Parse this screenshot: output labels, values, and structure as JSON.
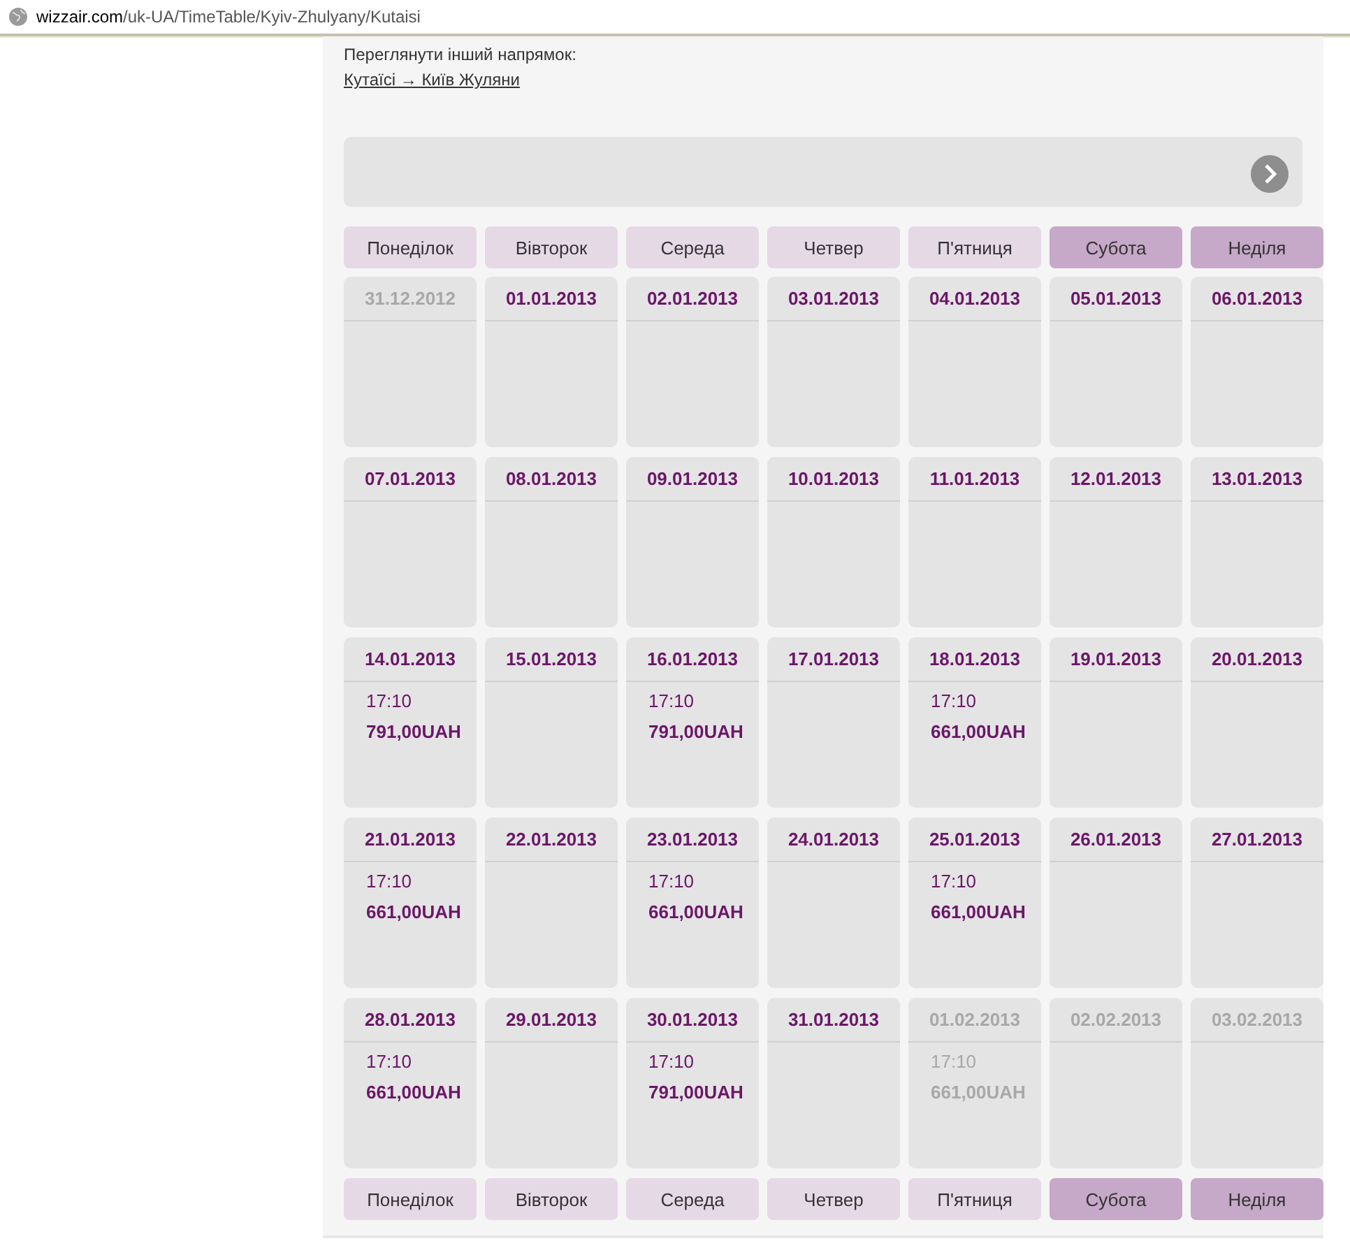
{
  "address_bar": {
    "host": "wizzair.com",
    "path": "/uk-UA/TimeTable/Kyiv-Zhulyany/Kutaisi"
  },
  "other_direction": {
    "label": "Переглянути інший напрямок:",
    "link": "Кутаїсі → Київ Жуляни"
  },
  "weekdays_top": [
    {
      "label": "Понеділок",
      "weekend": false
    },
    {
      "label": "Вівторок",
      "weekend": false
    },
    {
      "label": "Середа",
      "weekend": false
    },
    {
      "label": "Четвер",
      "weekend": false
    },
    {
      "label": "П'ятниця",
      "weekend": false
    },
    {
      "label": "Субота",
      "weekend": true
    },
    {
      "label": "Неділя",
      "weekend": true
    }
  ],
  "days": [
    {
      "date": "31.12.2012",
      "muted": true
    },
    {
      "date": "01.01.2013",
      "muted": false
    },
    {
      "date": "02.01.2013",
      "muted": false
    },
    {
      "date": "03.01.2013",
      "muted": false
    },
    {
      "date": "04.01.2013",
      "muted": false
    },
    {
      "date": "05.01.2013",
      "muted": false
    },
    {
      "date": "06.01.2013",
      "muted": false
    },
    {
      "date": "07.01.2013",
      "muted": false
    },
    {
      "date": "08.01.2013",
      "muted": false
    },
    {
      "date": "09.01.2013",
      "muted": false
    },
    {
      "date": "10.01.2013",
      "muted": false
    },
    {
      "date": "11.01.2013",
      "muted": false
    },
    {
      "date": "12.01.2013",
      "muted": false
    },
    {
      "date": "13.01.2013",
      "muted": false
    },
    {
      "date": "14.01.2013",
      "muted": false,
      "time": "17:10",
      "price": "791,00UAH"
    },
    {
      "date": "15.01.2013",
      "muted": false
    },
    {
      "date": "16.01.2013",
      "muted": false,
      "time": "17:10",
      "price": "791,00UAH"
    },
    {
      "date": "17.01.2013",
      "muted": false
    },
    {
      "date": "18.01.2013",
      "muted": false,
      "time": "17:10",
      "price": "661,00UAH"
    },
    {
      "date": "19.01.2013",
      "muted": false
    },
    {
      "date": "20.01.2013",
      "muted": false
    },
    {
      "date": "21.01.2013",
      "muted": false,
      "time": "17:10",
      "price": "661,00UAH"
    },
    {
      "date": "22.01.2013",
      "muted": false
    },
    {
      "date": "23.01.2013",
      "muted": false,
      "time": "17:10",
      "price": "661,00UAH"
    },
    {
      "date": "24.01.2013",
      "muted": false
    },
    {
      "date": "25.01.2013",
      "muted": false,
      "time": "17:10",
      "price": "661,00UAH"
    },
    {
      "date": "26.01.2013",
      "muted": false
    },
    {
      "date": "27.01.2013",
      "muted": false
    },
    {
      "date": "28.01.2013",
      "muted": false,
      "time": "17:10",
      "price": "661,00UAH"
    },
    {
      "date": "29.01.2013",
      "muted": false
    },
    {
      "date": "30.01.2013",
      "muted": false,
      "time": "17:10",
      "price": "791,00UAH"
    },
    {
      "date": "31.01.2013",
      "muted": false
    },
    {
      "date": "01.02.2013",
      "muted": true,
      "time": "17:10",
      "price": "661,00UAH"
    },
    {
      "date": "02.02.2013",
      "muted": true
    },
    {
      "date": "03.02.2013",
      "muted": true
    }
  ],
  "weekdays_bottom": [
    {
      "label": "Понеділок",
      "weekend": false
    },
    {
      "label": "Вівторок",
      "weekend": false
    },
    {
      "label": "Середа",
      "weekend": false
    },
    {
      "label": "Четвер",
      "weekend": false
    },
    {
      "label": "П'ятниця",
      "weekend": false
    },
    {
      "label": "Субота",
      "weekend": true
    },
    {
      "label": "Неділя",
      "weekend": true
    }
  ]
}
